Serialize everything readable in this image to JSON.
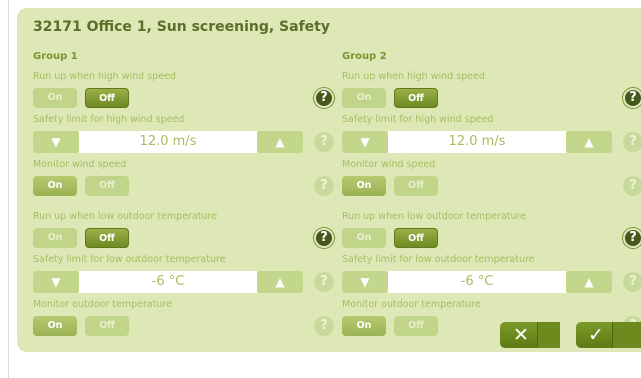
{
  "dialog": {
    "title": "32171 Office 1, Sun screening, Safety",
    "cancel_icon": "close-x-icon",
    "ok_icon": "checkmark-icon"
  },
  "groups": [
    {
      "name": "Group 1",
      "run_up_high_wind": {
        "label": "Run up when high wind speed",
        "on": "On",
        "off": "Off",
        "state": "off"
      },
      "high_wind_limit": {
        "label": "Safety limit for high wind speed",
        "value": "12.0 m/s"
      },
      "monitor_wind": {
        "label": "Monitor wind speed",
        "on": "On",
        "off": "Off",
        "state": "on"
      },
      "run_up_low_temp": {
        "label": "Run up when low outdoor temperature",
        "on": "On",
        "off": "Off",
        "state": "off"
      },
      "low_temp_limit": {
        "label": "Safety limit for low outdoor temperature",
        "value": "-6 °C"
      },
      "monitor_temp": {
        "label": "Monitor outdoor temperature",
        "on": "On",
        "off": "Off",
        "state": "on"
      },
      "help": "?"
    },
    {
      "name": "Group 2",
      "run_up_high_wind": {
        "label": "Run up when high wind speed",
        "on": "On",
        "off": "Off",
        "state": "off"
      },
      "high_wind_limit": {
        "label": "Safety limit for high wind speed",
        "value": "12.0 m/s"
      },
      "monitor_wind": {
        "label": "Monitor wind speed",
        "on": "On",
        "off": "Off",
        "state": "on"
      },
      "run_up_low_temp": {
        "label": "Run up when low outdoor temperature",
        "on": "On",
        "off": "Off",
        "state": "off"
      },
      "low_temp_limit": {
        "label": "Safety limit for low outdoor temperature",
        "value": "-6 °C"
      },
      "monitor_temp": {
        "label": "Monitor outdoor temperature",
        "on": "On",
        "off": "Off",
        "state": "on"
      },
      "help": "?"
    }
  ],
  "colors": {
    "panel": "#dde8b6",
    "accent_dark": "#6e8a22",
    "label": "#a6bd62",
    "title": "#5c6e2a"
  }
}
